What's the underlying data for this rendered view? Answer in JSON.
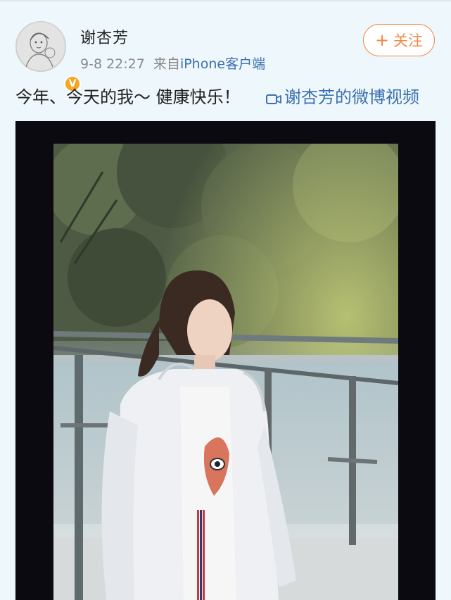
{
  "post": {
    "username": "谢杏芳",
    "time": "9-8 22:27",
    "source_prefix": "来自",
    "source": "iPhone客户端",
    "follow_label": "关注",
    "text": "今年、今天的我～ 健康快乐！",
    "video_link": "谢杏芳的微博视频"
  },
  "icons": {
    "avatar": "avatar-sketch",
    "verified": "verified-badge-icon",
    "follow": "plus-icon",
    "video": "video-camera-icon"
  },
  "colors": {
    "accent_orange": "#f08a4b",
    "link_blue": "#3a6fb0",
    "verified_gold": "#f6a623",
    "meta_gray": "#8a8a8a"
  }
}
